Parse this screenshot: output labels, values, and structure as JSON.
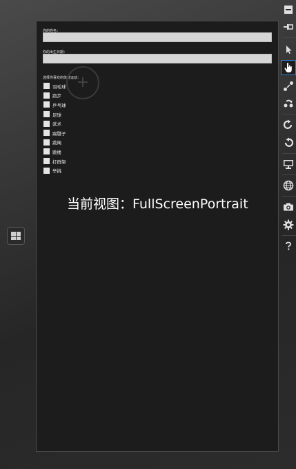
{
  "form": {
    "name_label": "你的姓名：",
    "name_value": "",
    "birthday_label": "你的出生日期：",
    "birthday_value": "",
    "sports_title": "选择你喜欢的体育运动：",
    "sports": [
      {
        "label": "羽毛球",
        "checked": false
      },
      {
        "label": "跑步",
        "checked": false
      },
      {
        "label": "乒乓球",
        "checked": false
      },
      {
        "label": "足球",
        "checked": false
      },
      {
        "label": "武术",
        "checked": false
      },
      {
        "label": "踢毽子",
        "checked": false
      },
      {
        "label": "跳绳",
        "checked": false
      },
      {
        "label": "跳楼",
        "checked": false
      },
      {
        "label": "打群架",
        "checked": false
      },
      {
        "label": "举挑",
        "checked": false
      }
    ]
  },
  "view_caption": "当前视图：FullScreenPortrait",
  "toolbar": {
    "tools": [
      "minimize-icon",
      "pin-icon",
      "mouse-pointer-icon",
      "touch-hand-icon",
      "pinch-zoom-icon",
      "rotation-gesture-icon",
      "rotate-clockwise-icon",
      "rotate-counterclockwise-icon",
      "change-resolution-icon",
      "set-location-icon",
      "screenshot-icon",
      "settings-icon",
      "help-icon"
    ],
    "active_tool": "touch-hand-icon"
  },
  "colors": {
    "active_accent": "#2f7fd6",
    "app_background": "#1c1c1c"
  }
}
